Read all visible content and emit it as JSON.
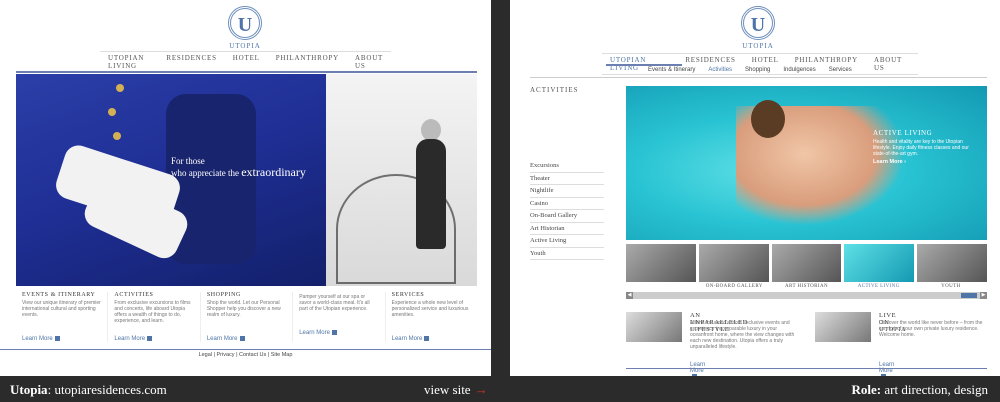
{
  "left": {
    "logo_name": "UTOPIA",
    "logo_letter": "U",
    "nav": [
      "Utopian Living",
      "Residences",
      "Hotel",
      "Philanthropy",
      "About Us"
    ],
    "tagline_line1": "For those",
    "tagline_line2": "who appreciate the",
    "tagline_big": "extraordinary",
    "columns": [
      {
        "heading": "Events & Itinerary",
        "text": "View our unique itinerary of premier international cultural and sporting events.",
        "link": "Learn More"
      },
      {
        "heading": "Activities",
        "text": "From exclusive excursions to films and concerts, life aboard Utopia offers a wealth of things to do, experience, and learn.",
        "link": "Learn More"
      },
      {
        "heading": "Shopping",
        "text": "Shop the world. Let our Personal Shopper help you discover a new realm of luxury.",
        "link": "Learn More"
      },
      {
        "heading": "",
        "text": "Pamper yourself at our spa or savor a world-class meal. It's all part of the Utopian experience.",
        "link": "Learn More"
      },
      {
        "heading": "Services",
        "text": "Experience a whole new level of personalized service and luxurious amenities.",
        "link": "Learn More"
      }
    ],
    "legal": "Legal  |  Privacy  |  Contact Us  |  Site Map"
  },
  "right": {
    "logo_name": "UTOPIA",
    "logo_letter": "U",
    "nav": [
      "Utopian Living",
      "Residences",
      "Hotel",
      "Philanthropy",
      "About Us"
    ],
    "subnav": [
      "Events & Itinerary",
      "Activities",
      "Shopping",
      "Indulgences",
      "Services"
    ],
    "subnav_active": "Activities",
    "side_heading": "Activities",
    "side_items": [
      "Excursions",
      "Theater",
      "Nightlife",
      "Casino",
      "On-Board Gallery",
      "Art Historian",
      "Active Living",
      "Youth"
    ],
    "feature_heading": "Active Living",
    "feature_text": "Health and vitality are key to the Utopian lifestyle. Enjoy daily fitness classes and our state-of-the-art gym.",
    "feature_link": "Learn More ›",
    "thumb_labels": [
      "",
      "On-Board Gallery",
      "Art Historian",
      "Active Living",
      "Youth"
    ],
    "thumb_active": "Active Living",
    "promo1": {
      "heading": "An Unparalleled Lifestyle",
      "text": "Attend the world's most exclusive events and experience incomparable luxury in your oceanfront home, where the view changes with each new destination. Utopia offers a truly unparalleled lifestyle.",
      "link": "Learn More"
    },
    "promo2": {
      "heading": "Live on Utopia",
      "text": "Discover the world like never before – from the comfort of your own private luxury residence. Welcome home.",
      "link": "Learn More"
    }
  },
  "footer": {
    "site_name": "Utopia",
    "site_url": "utopiaresidences.com",
    "view_site": "view site",
    "arrow": "→",
    "role_label": "Role:",
    "role_value": "art direction, design"
  },
  "colors": {
    "accent": "#4e74a8",
    "navy": "#1f2f96",
    "red_arrow": "#d6302a",
    "pool": "#28c3d3"
  }
}
